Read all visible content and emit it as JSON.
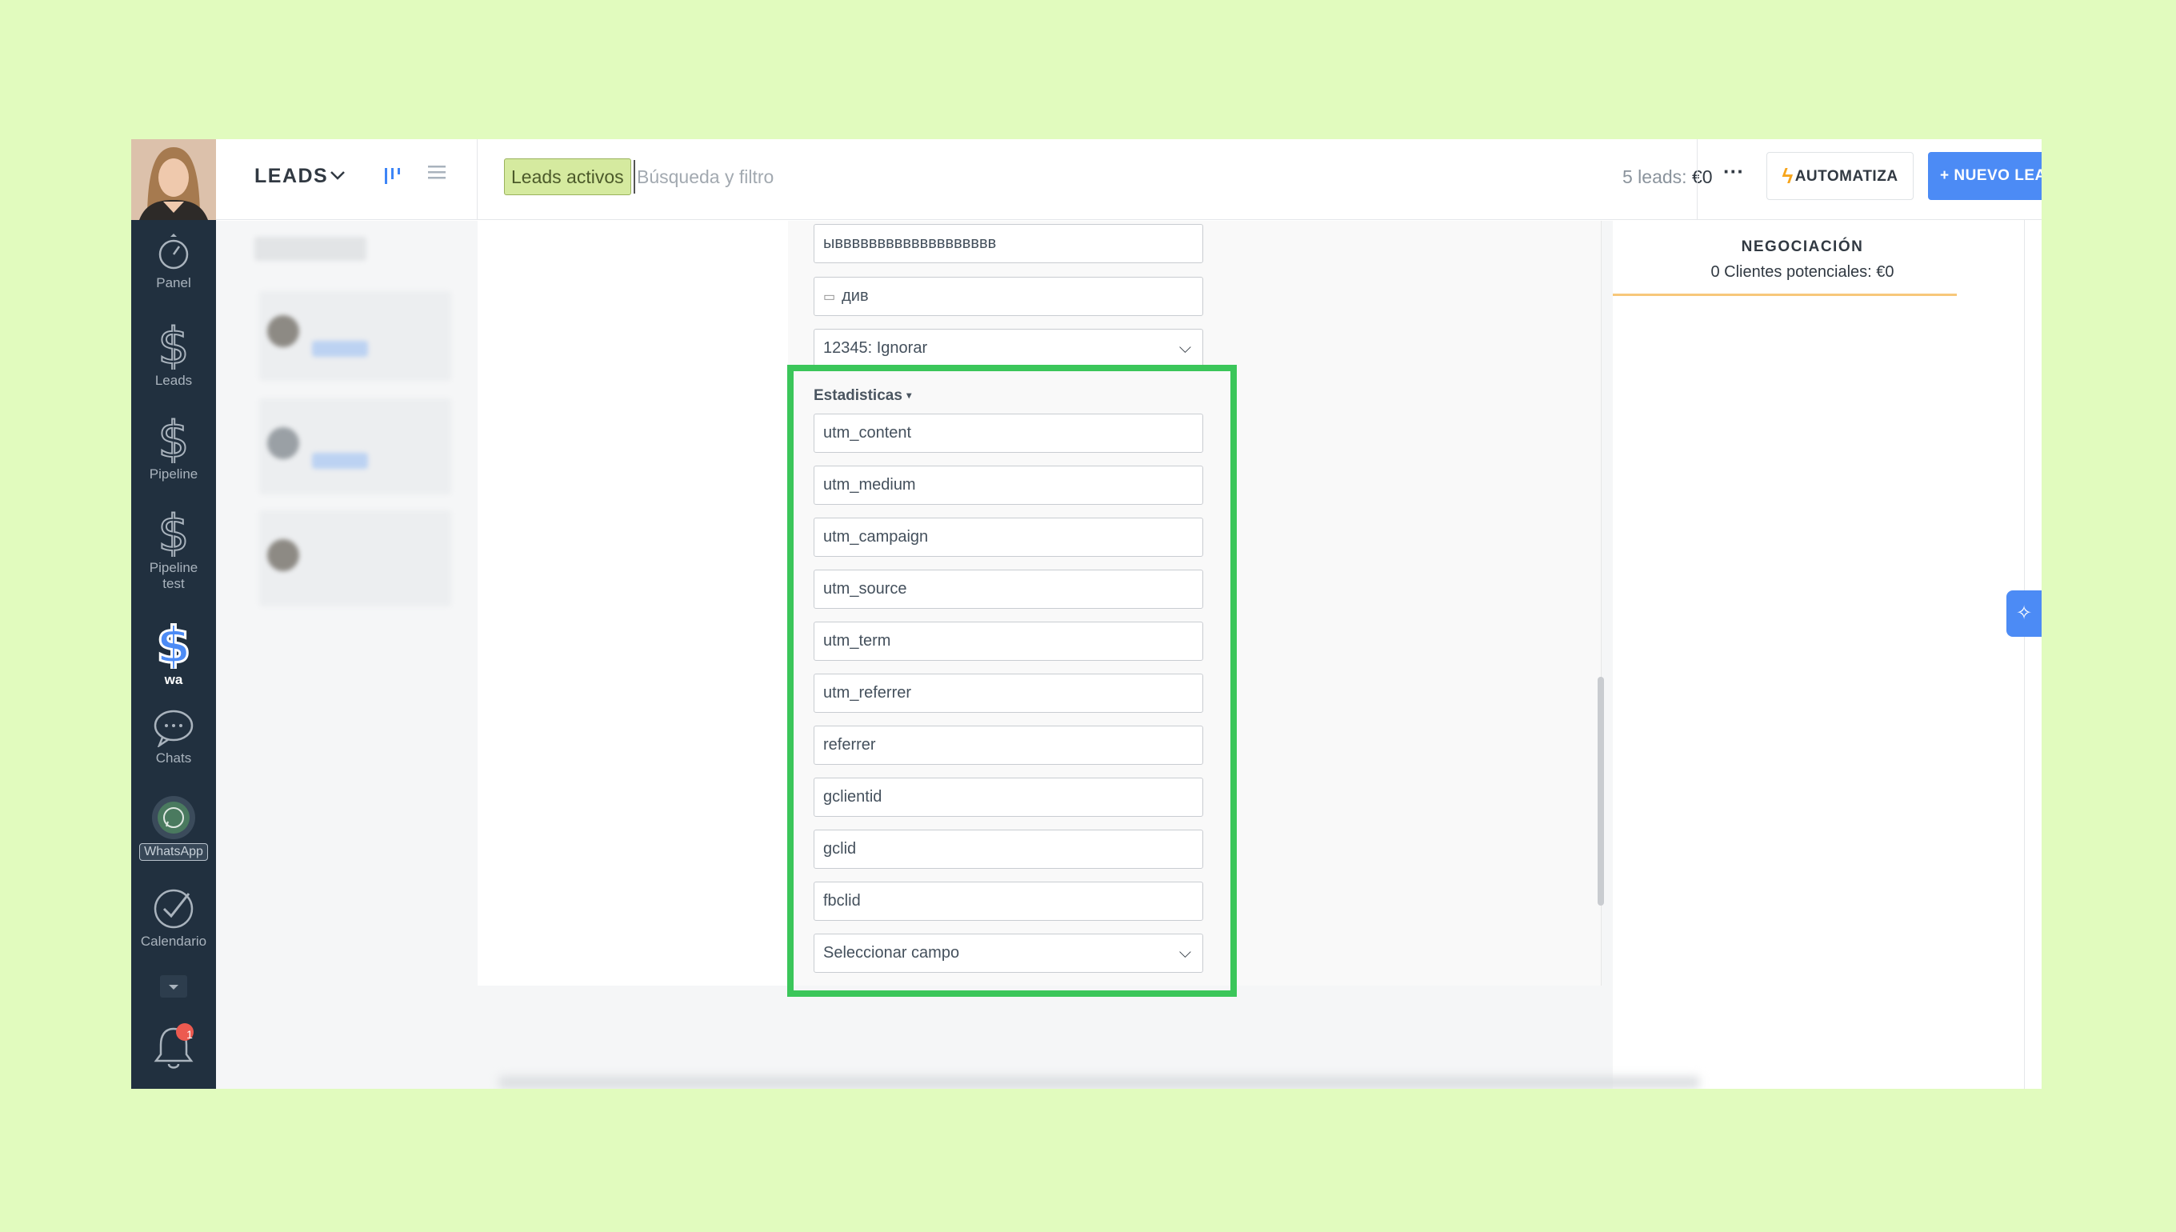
{
  "header": {
    "title": "LEADS",
    "filter_chip": "Leads activos",
    "search_placeholder": "Búsqueda y filtro",
    "leads_count_prefix": "5 leads: ",
    "leads_count_value": "€0",
    "more_label": "···",
    "automatiza_label": "AUTOMATIZA",
    "nuevo_label": "+ NUEVO LEAD"
  },
  "sidebar": {
    "items": [
      {
        "label": "Panel",
        "icon": "speedometer-icon"
      },
      {
        "label": "Leads",
        "icon": "dollar-icon"
      },
      {
        "label": "Pipeline",
        "icon": "dollar-icon"
      },
      {
        "label": "Pipeline test",
        "icon": "dollar-icon"
      },
      {
        "label": "wa",
        "icon": "dollar-icon",
        "active": true
      },
      {
        "label": "Chats",
        "icon": "chat-icon"
      },
      {
        "label": "WhatsApp",
        "icon": "whatsapp-icon"
      },
      {
        "label": "Calendario",
        "icon": "check-circle-icon"
      }
    ],
    "notifications_badge": "1"
  },
  "stage": {
    "title": "NEGOCIACIÓN",
    "subtitle": "0 Clientes potenciales: €0"
  },
  "form": {
    "field_text": "ыввввввввввввввввввв",
    "field_date": "див",
    "field_select": "12345: Ignorar",
    "section_label": "Estadisticas",
    "stats_fields": [
      "utm_content",
      "utm_medium",
      "utm_campaign",
      "utm_source",
      "utm_term",
      "utm_referrer",
      "referrer",
      "gclientid",
      "gclid",
      "fbclid"
    ],
    "select_field": "Seleccionar campo"
  },
  "colors": {
    "background": "#e1fbbe",
    "sidebar": "#21303f",
    "accent_blue": "#4c8bf5",
    "highlight_green": "#3bc65a",
    "chip_green": "#d5ea9f",
    "stage_line": "#f7c77a"
  }
}
